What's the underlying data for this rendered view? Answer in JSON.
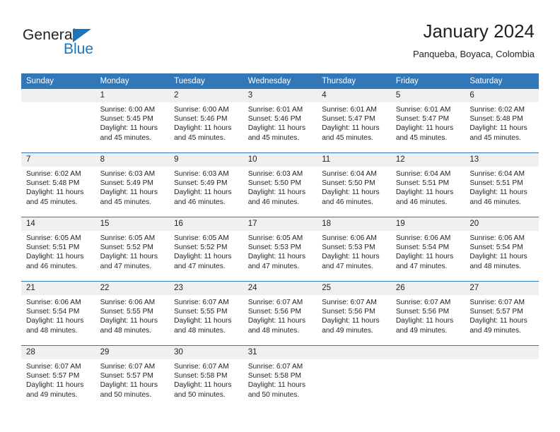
{
  "brand": {
    "name_part1": "General",
    "name_part2": "Blue",
    "logo_icon": "triangle-icon",
    "accent_color": "#1b75bb"
  },
  "header": {
    "title": "January 2024",
    "subtitle": "Panqueba, Boyaca, Colombia"
  },
  "theme": {
    "header_bar_color": "#3277b8",
    "daynum_band_color": "#f0f0f0",
    "text_color": "#231f20"
  },
  "calendar": {
    "weekday_headers": [
      "Sunday",
      "Monday",
      "Tuesday",
      "Wednesday",
      "Thursday",
      "Friday",
      "Saturday"
    ],
    "labels": {
      "sunrise": "Sunrise:",
      "sunset": "Sunset:",
      "daylight": "Daylight:"
    },
    "weeks": [
      [
        {
          "day": "",
          "empty": true
        },
        {
          "day": "1",
          "sunrise": "Sunrise: 6:00 AM",
          "sunset": "Sunset: 5:45 PM",
          "daylight_line1": "Daylight: 11 hours",
          "daylight_line2": "and 45 minutes."
        },
        {
          "day": "2",
          "sunrise": "Sunrise: 6:00 AM",
          "sunset": "Sunset: 5:46 PM",
          "daylight_line1": "Daylight: 11 hours",
          "daylight_line2": "and 45 minutes."
        },
        {
          "day": "3",
          "sunrise": "Sunrise: 6:01 AM",
          "sunset": "Sunset: 5:46 PM",
          "daylight_line1": "Daylight: 11 hours",
          "daylight_line2": "and 45 minutes."
        },
        {
          "day": "4",
          "sunrise": "Sunrise: 6:01 AM",
          "sunset": "Sunset: 5:47 PM",
          "daylight_line1": "Daylight: 11 hours",
          "daylight_line2": "and 45 minutes."
        },
        {
          "day": "5",
          "sunrise": "Sunrise: 6:01 AM",
          "sunset": "Sunset: 5:47 PM",
          "daylight_line1": "Daylight: 11 hours",
          "daylight_line2": "and 45 minutes."
        },
        {
          "day": "6",
          "sunrise": "Sunrise: 6:02 AM",
          "sunset": "Sunset: 5:48 PM",
          "daylight_line1": "Daylight: 11 hours",
          "daylight_line2": "and 45 minutes."
        }
      ],
      [
        {
          "day": "7",
          "sunrise": "Sunrise: 6:02 AM",
          "sunset": "Sunset: 5:48 PM",
          "daylight_line1": "Daylight: 11 hours",
          "daylight_line2": "and 45 minutes."
        },
        {
          "day": "8",
          "sunrise": "Sunrise: 6:03 AM",
          "sunset": "Sunset: 5:49 PM",
          "daylight_line1": "Daylight: 11 hours",
          "daylight_line2": "and 45 minutes."
        },
        {
          "day": "9",
          "sunrise": "Sunrise: 6:03 AM",
          "sunset": "Sunset: 5:49 PM",
          "daylight_line1": "Daylight: 11 hours",
          "daylight_line2": "and 46 minutes."
        },
        {
          "day": "10",
          "sunrise": "Sunrise: 6:03 AM",
          "sunset": "Sunset: 5:50 PM",
          "daylight_line1": "Daylight: 11 hours",
          "daylight_line2": "and 46 minutes."
        },
        {
          "day": "11",
          "sunrise": "Sunrise: 6:04 AM",
          "sunset": "Sunset: 5:50 PM",
          "daylight_line1": "Daylight: 11 hours",
          "daylight_line2": "and 46 minutes."
        },
        {
          "day": "12",
          "sunrise": "Sunrise: 6:04 AM",
          "sunset": "Sunset: 5:51 PM",
          "daylight_line1": "Daylight: 11 hours",
          "daylight_line2": "and 46 minutes."
        },
        {
          "day": "13",
          "sunrise": "Sunrise: 6:04 AM",
          "sunset": "Sunset: 5:51 PM",
          "daylight_line1": "Daylight: 11 hours",
          "daylight_line2": "and 46 minutes."
        }
      ],
      [
        {
          "day": "14",
          "sunrise": "Sunrise: 6:05 AM",
          "sunset": "Sunset: 5:51 PM",
          "daylight_line1": "Daylight: 11 hours",
          "daylight_line2": "and 46 minutes."
        },
        {
          "day": "15",
          "sunrise": "Sunrise: 6:05 AM",
          "sunset": "Sunset: 5:52 PM",
          "daylight_line1": "Daylight: 11 hours",
          "daylight_line2": "and 47 minutes."
        },
        {
          "day": "16",
          "sunrise": "Sunrise: 6:05 AM",
          "sunset": "Sunset: 5:52 PM",
          "daylight_line1": "Daylight: 11 hours",
          "daylight_line2": "and 47 minutes."
        },
        {
          "day": "17",
          "sunrise": "Sunrise: 6:05 AM",
          "sunset": "Sunset: 5:53 PM",
          "daylight_line1": "Daylight: 11 hours",
          "daylight_line2": "and 47 minutes."
        },
        {
          "day": "18",
          "sunrise": "Sunrise: 6:06 AM",
          "sunset": "Sunset: 5:53 PM",
          "daylight_line1": "Daylight: 11 hours",
          "daylight_line2": "and 47 minutes."
        },
        {
          "day": "19",
          "sunrise": "Sunrise: 6:06 AM",
          "sunset": "Sunset: 5:54 PM",
          "daylight_line1": "Daylight: 11 hours",
          "daylight_line2": "and 47 minutes."
        },
        {
          "day": "20",
          "sunrise": "Sunrise: 6:06 AM",
          "sunset": "Sunset: 5:54 PM",
          "daylight_line1": "Daylight: 11 hours",
          "daylight_line2": "and 48 minutes."
        }
      ],
      [
        {
          "day": "21",
          "sunrise": "Sunrise: 6:06 AM",
          "sunset": "Sunset: 5:54 PM",
          "daylight_line1": "Daylight: 11 hours",
          "daylight_line2": "and 48 minutes."
        },
        {
          "day": "22",
          "sunrise": "Sunrise: 6:06 AM",
          "sunset": "Sunset: 5:55 PM",
          "daylight_line1": "Daylight: 11 hours",
          "daylight_line2": "and 48 minutes."
        },
        {
          "day": "23",
          "sunrise": "Sunrise: 6:07 AM",
          "sunset": "Sunset: 5:55 PM",
          "daylight_line1": "Daylight: 11 hours",
          "daylight_line2": "and 48 minutes."
        },
        {
          "day": "24",
          "sunrise": "Sunrise: 6:07 AM",
          "sunset": "Sunset: 5:56 PM",
          "daylight_line1": "Daylight: 11 hours",
          "daylight_line2": "and 48 minutes."
        },
        {
          "day": "25",
          "sunrise": "Sunrise: 6:07 AM",
          "sunset": "Sunset: 5:56 PM",
          "daylight_line1": "Daylight: 11 hours",
          "daylight_line2": "and 49 minutes."
        },
        {
          "day": "26",
          "sunrise": "Sunrise: 6:07 AM",
          "sunset": "Sunset: 5:56 PM",
          "daylight_line1": "Daylight: 11 hours",
          "daylight_line2": "and 49 minutes."
        },
        {
          "day": "27",
          "sunrise": "Sunrise: 6:07 AM",
          "sunset": "Sunset: 5:57 PM",
          "daylight_line1": "Daylight: 11 hours",
          "daylight_line2": "and 49 minutes."
        }
      ],
      [
        {
          "day": "28",
          "sunrise": "Sunrise: 6:07 AM",
          "sunset": "Sunset: 5:57 PM",
          "daylight_line1": "Daylight: 11 hours",
          "daylight_line2": "and 49 minutes."
        },
        {
          "day": "29",
          "sunrise": "Sunrise: 6:07 AM",
          "sunset": "Sunset: 5:57 PM",
          "daylight_line1": "Daylight: 11 hours",
          "daylight_line2": "and 50 minutes."
        },
        {
          "day": "30",
          "sunrise": "Sunrise: 6:07 AM",
          "sunset": "Sunset: 5:58 PM",
          "daylight_line1": "Daylight: 11 hours",
          "daylight_line2": "and 50 minutes."
        },
        {
          "day": "31",
          "sunrise": "Sunrise: 6:07 AM",
          "sunset": "Sunset: 5:58 PM",
          "daylight_line1": "Daylight: 11 hours",
          "daylight_line2": "and 50 minutes."
        },
        {
          "day": "",
          "empty": true
        },
        {
          "day": "",
          "empty": true
        },
        {
          "day": "",
          "empty": true
        }
      ]
    ]
  }
}
